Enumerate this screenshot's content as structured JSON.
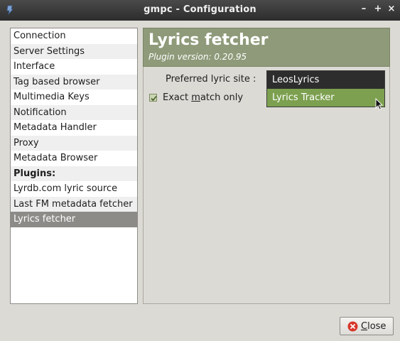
{
  "window": {
    "title": "gmpc - Configuration",
    "controls": [
      "–",
      "+",
      "×"
    ]
  },
  "sidebar": {
    "items": [
      {
        "label": "Connection"
      },
      {
        "label": "Server Settings"
      },
      {
        "label": "Interface"
      },
      {
        "label": "Tag based browser"
      },
      {
        "label": "Multimedia Keys"
      },
      {
        "label": "Notification"
      },
      {
        "label": "Metadata Handler"
      },
      {
        "label": "Proxy"
      },
      {
        "label": "Metadata Browser"
      },
      {
        "label": "Plugins:"
      },
      {
        "label": "Lyrdb.com lyric source"
      },
      {
        "label": "Last FM metadata fetcher"
      },
      {
        "label": "Lyrics fetcher"
      }
    ],
    "selected": "Lyrics fetcher"
  },
  "plugin": {
    "title": "Lyrics fetcher",
    "version": "Plugin version: 0.20.95"
  },
  "settings": {
    "lyric_site_label": "Preferred lyric site :",
    "exact_match_label_pre": "Exact ",
    "exact_match_label_underline": "m",
    "exact_match_label_post": "atch only",
    "exact_match_checked": true
  },
  "dropdown": {
    "options": [
      "LeosLyrics",
      "Lyrics Tracker"
    ],
    "highlighted": "Lyrics Tracker"
  },
  "footer": {
    "close_label_underline": "C",
    "close_label_rest": "lose"
  },
  "colors": {
    "header_bg": "#8e9a79",
    "highlight": "#7ca04f",
    "selected_row": "#8c8b88"
  }
}
